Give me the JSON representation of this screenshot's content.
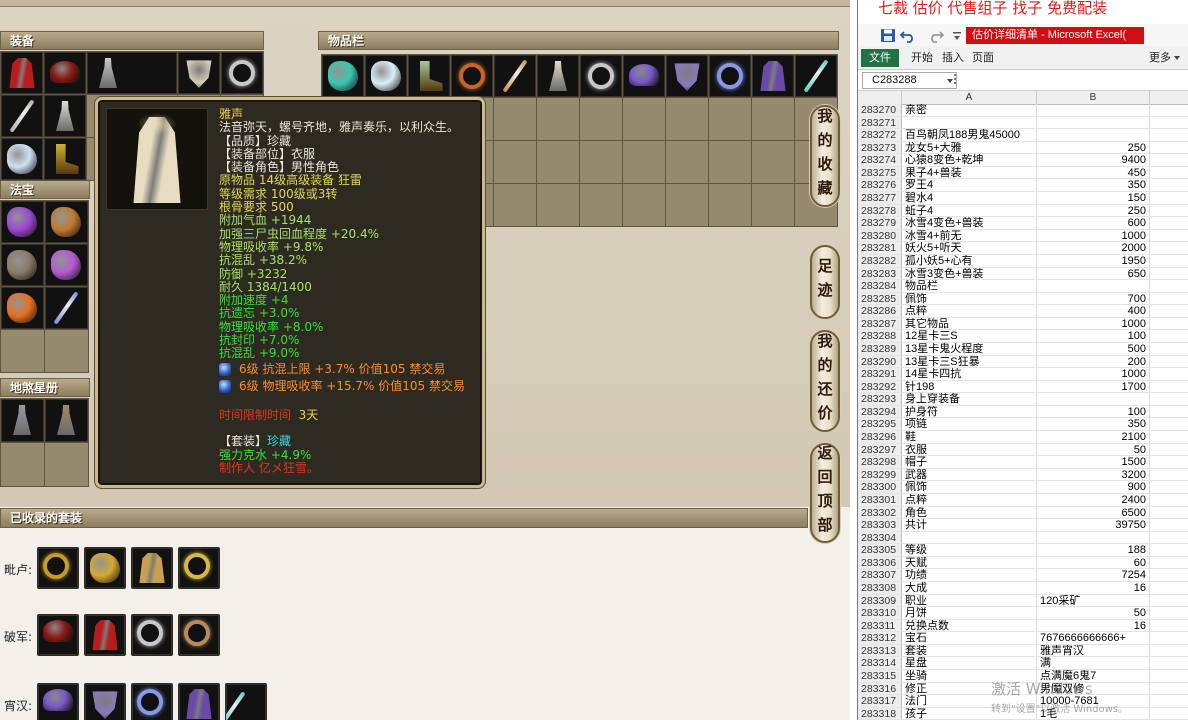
{
  "game": {
    "equip_header": "装备",
    "inventory_header": "物品栏",
    "treasure_header": "法宝",
    "starbook_header": "地煞星册",
    "sets_header": "已收录的套装",
    "nav": [
      "我的收藏",
      "足迹",
      "我的还价",
      "返回顶部"
    ],
    "equip_icons": [
      {
        "icon": "robe",
        "color": "#b81c1c"
      },
      {
        "icon": "helmet",
        "color": "#8a1a14"
      },
      {
        "icon": "character-preview",
        "color": "#c8c8c8"
      },
      {
        "icon": "mask",
        "color": "#d8cfb8"
      },
      {
        "icon": "necklace",
        "color": "#c8c8c8"
      },
      {
        "icon": "spear",
        "color": "#b8b0a8"
      },
      {
        "icon": "doll",
        "color": "#e0dcd4"
      },
      null,
      null,
      null,
      {
        "icon": "lantern",
        "color": "#cfe0f0"
      },
      {
        "icon": "boots",
        "color": "#d8b030"
      },
      null,
      null,
      null
    ],
    "treasure_icons": [
      {
        "icon": "claw",
        "color": "#9a48d0"
      },
      {
        "icon": "scroll",
        "color": "#c07a30"
      },
      {
        "icon": "stone",
        "color": "#8a7a68"
      },
      {
        "icon": "whip",
        "color": "#b45ad0"
      },
      {
        "icon": "fire-gem",
        "color": "#e87020"
      },
      {
        "icon": "ice-blade",
        "color": "#7090e0"
      },
      null,
      null
    ],
    "starbook_icons": [
      {
        "icon": "warrior-card",
        "color": "#9a9aa8"
      },
      {
        "icon": "warrior-card",
        "color": "#a88866"
      },
      null,
      null
    ],
    "inventory_icons": [
      {
        "icon": "jade-leaf",
        "color": "#38c8b0"
      },
      {
        "icon": "cloud-sash",
        "color": "#d8eef8"
      },
      {
        "icon": "boots",
        "color": "#a8c8a0"
      },
      {
        "icon": "bead-necklace",
        "color": "#c8642a"
      },
      {
        "icon": "sword",
        "color": "#c89048"
      },
      {
        "icon": "robe-figure",
        "color": "#e4dccc"
      },
      {
        "icon": "necklace",
        "color": "#c8c8c8"
      },
      {
        "icon": "bat-hat",
        "color": "#7a5ac8"
      },
      {
        "icon": "horned-mask",
        "color": "#8a78c0"
      },
      {
        "icon": "ring",
        "color": "#8898e8"
      },
      {
        "icon": "cloak",
        "color": "#6a4aa8"
      },
      {
        "icon": "staff",
        "color": "#58d0c0"
      }
    ],
    "sets": [
      {
        "label": "毗卢:",
        "icons": [
          {
            "icon": "amulet",
            "color": "#c89a28"
          },
          {
            "icon": "orb",
            "color": "#d8a830"
          },
          {
            "icon": "robe",
            "color": "#c8a050"
          },
          {
            "icon": "ring",
            "color": "#d8b840"
          }
        ]
      },
      {
        "label": "破军:",
        "icons": [
          {
            "icon": "helmet",
            "color": "#8a1a14"
          },
          {
            "icon": "robe",
            "color": "#b81c1c"
          },
          {
            "icon": "ring",
            "color": "#c8c8c8"
          },
          {
            "icon": "necklace",
            "color": "#b88a60"
          }
        ]
      },
      {
        "label": "宵汉:",
        "icons": [
          {
            "icon": "bat-hat",
            "color": "#7a5ac8"
          },
          {
            "icon": "horned-mask",
            "color": "#8a78c0"
          },
          {
            "icon": "ring",
            "color": "#8898e8"
          },
          {
            "icon": "cloak",
            "color": "#6a4aa8"
          },
          {
            "icon": "staff",
            "color": "#58d0c0"
          }
        ]
      }
    ]
  },
  "tooltip": {
    "portrait": {
      "icon": "robe",
      "color": "#e8dcc0"
    },
    "name": "雅声",
    "desc": "法音弥天，螺号齐地，雅声奏乐，以利众生。",
    "quality": "【品质】珍藏",
    "slot": "【装备部位】衣服",
    "role": "【装备角色】男性角色",
    "origin": "原物品 14级高级装备 狂雷",
    "level_req": "等级需求 100级或3转",
    "bone_req": "根骨要求 500",
    "base_stats": [
      "附加气血 +1944",
      "加强三尸虫回血程度 +20.4%",
      "物理吸收率 +9.8%",
      "抗混乱 +38.2%",
      "防御 +3232",
      "耐久 1384/1400"
    ],
    "extra_stats": [
      "附加速度 +4",
      "抗遗忘 +3.0%",
      "物理吸收率 +8.0%",
      "抗封印 +7.0%",
      "抗混乱 +9.0%"
    ],
    "gems": [
      "6级 抗混上限 +3.7% 价值105 禁交易",
      "6级 物理吸收率 +15.7% 价值105 禁交易"
    ],
    "time_limit_label": "时间限制时间",
    "time_limit_value": "3天",
    "set_label": "【套装】",
    "set_name": "珍藏",
    "set_bonus": "强力克水 +4.9%",
    "maker": "制作人 亿メ狂雪。"
  },
  "excel": {
    "banner": "七裁 估价 代售组子 找子 免费配装",
    "title": "估价详细清单 - Microsoft Excel(",
    "tabs": [
      "文件",
      "开始",
      "插入",
      "页面",
      "更多"
    ],
    "name_box": "C283288",
    "col_headers": [
      "A",
      "B"
    ],
    "rows": [
      [
        "283270",
        "亲密",
        ""
      ],
      [
        "283271",
        "",
        ""
      ],
      [
        "283272",
        "百鸟朝凤188男鬼45000",
        ""
      ],
      [
        "283273",
        "龙女5+大雅",
        "250"
      ],
      [
        "283274",
        "心猿8变色+乾坤",
        "9400"
      ],
      [
        "283275",
        "果子4+兽装",
        "450"
      ],
      [
        "283276",
        "罗王4",
        "350"
      ],
      [
        "283277",
        "碧水4",
        "150"
      ],
      [
        "283278",
        "蚯子4",
        "250"
      ],
      [
        "283279",
        "冰雪4变色+兽装",
        "600"
      ],
      [
        "283280",
        "冰雪4+前无",
        "1000"
      ],
      [
        "283281",
        "妖火5+听天",
        "2000"
      ],
      [
        "283282",
        "孤小妖5+心有",
        "1950"
      ],
      [
        "283283",
        "冰雪3变色+兽装",
        "650"
      ],
      [
        "283284",
        "物品栏",
        ""
      ],
      [
        "283285",
        "佩饰",
        "700"
      ],
      [
        "283286",
        "点粹",
        "400"
      ],
      [
        "283287",
        "其它物品",
        "1000"
      ],
      [
        "283288",
        "12星卡三S",
        "100"
      ],
      [
        "283289",
        "13星卡鬼火程度",
        "500"
      ],
      [
        "283290",
        "13星卡三S狂暴",
        "200"
      ],
      [
        "283291",
        "14星卡四抗",
        "1000"
      ],
      [
        "283292",
        "针198",
        "1700"
      ],
      [
        "283293",
        "身上穿装备",
        ""
      ],
      [
        "283294",
        "护身符",
        "100"
      ],
      [
        "283295",
        "项链",
        "350"
      ],
      [
        "283296",
        "鞋",
        "2100"
      ],
      [
        "283297",
        "衣服",
        "50"
      ],
      [
        "283298",
        "帽子",
        "1500"
      ],
      [
        "283299",
        "武器",
        "3200"
      ],
      [
        "283300",
        "佩饰",
        "900"
      ],
      [
        "283301",
        "点粹",
        "2400"
      ],
      [
        "283302",
        "角色",
        "6500"
      ],
      [
        "283303",
        "共计",
        "39750"
      ],
      [
        "283304",
        "",
        ""
      ],
      [
        "283305",
        "等级",
        "188"
      ],
      [
        "283306",
        "天赋",
        "60"
      ],
      [
        "283307",
        "功绩",
        "7254"
      ],
      [
        "283308",
        "大成",
        "16"
      ],
      [
        "283309",
        "职业",
        "120采矿"
      ],
      [
        "283310",
        "月饼",
        "50"
      ],
      [
        "283311",
        "兑换点数",
        "16"
      ],
      [
        "283312",
        "宝石",
        "7676666666666+"
      ],
      [
        "283313",
        "套装",
        "雅声宵汉"
      ],
      [
        "283314",
        "星盘",
        "满"
      ],
      [
        "283315",
        "坐骑",
        "点满魔6鬼7"
      ],
      [
        "283316",
        "修正",
        "男魔双修"
      ],
      [
        "283317",
        "法门",
        "10000-7681"
      ],
      [
        "283318",
        "孩子",
        "1毛"
      ]
    ],
    "watermark_title": "激活 Windows",
    "watermark_sub": "转到\"设置\"以激活 Windows。",
    "accent_color": "#217346",
    "title_color": "#d10f12"
  }
}
